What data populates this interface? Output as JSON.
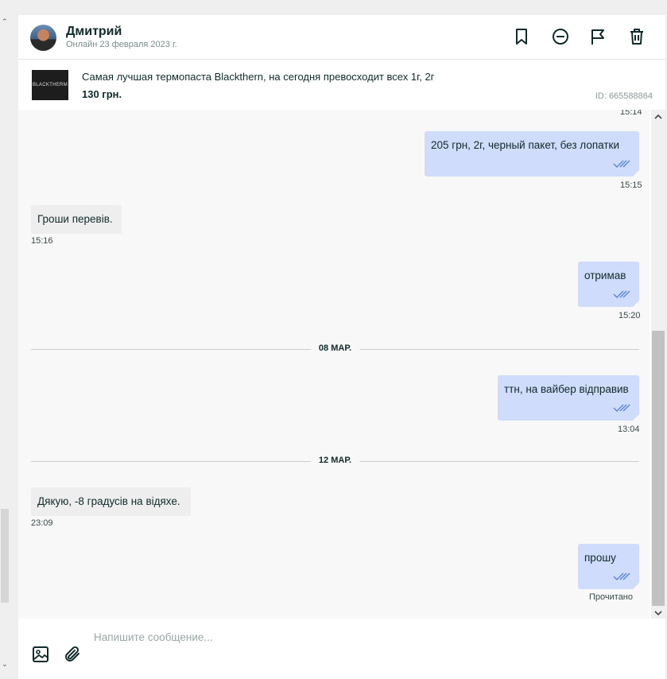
{
  "header": {
    "name": "Дмитрий",
    "status": "Онлайн 23 февраля 2023 г.",
    "icons": [
      "bookmark-icon",
      "block-icon",
      "flag-icon",
      "trash-icon"
    ]
  },
  "product": {
    "thumb_text": "BLACKTHERM",
    "title": "Самая лучшая термопаста Blackthern, на сегодня превосходит всех 1г, 2г",
    "price": "130 грн.",
    "id": "ID: 665588864"
  },
  "messages": {
    "top_time": "15:14",
    "m1": {
      "text": "205 грн, 2г, черный пакет, без лопатки",
      "time": "15:15"
    },
    "m2": {
      "text": "Гроши перевів.",
      "time": "15:16"
    },
    "m3": {
      "text": "отримав",
      "time": "15:20"
    },
    "date1": "08 МАР.",
    "m4": {
      "text": "ттн, на вайбер відправив",
      "time": "13:04"
    },
    "date2": "12 МАР.",
    "m5": {
      "text": "Дякую, -8 градусів на відяхе.",
      "time": "23:09"
    },
    "m6": {
      "text": "прошу",
      "status": "Прочитано"
    }
  },
  "composer": {
    "placeholder": "Напишите сообщение...",
    "icons": [
      "image-icon",
      "paperclip-icon"
    ]
  },
  "colors": {
    "outgoing_bubble": "#cfdcfb",
    "incoming_bubble": "#eeeeee",
    "read_ticks": "#5b86d6"
  }
}
